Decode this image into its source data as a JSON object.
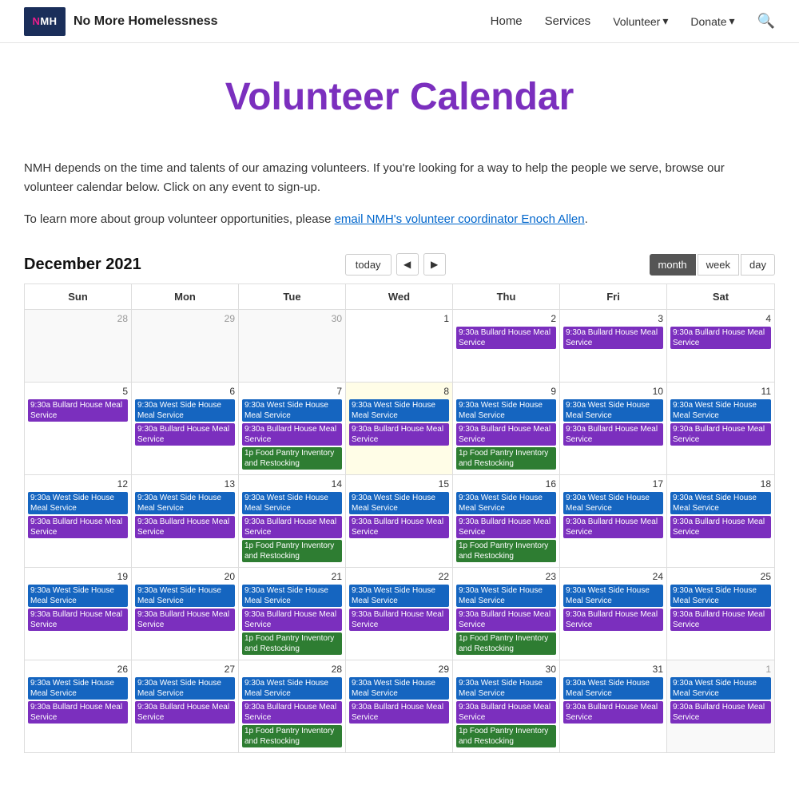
{
  "header": {
    "logo_text": "NMH",
    "site_name": "No More Homelessness",
    "nav": {
      "home": "Home",
      "services": "Services",
      "volunteer": "Volunteer",
      "donate": "Donate"
    }
  },
  "page": {
    "title": "Volunteer Calendar",
    "intro1": "NMH depends on the time and talents of our amazing volunteers. If you're looking for a way to help the people we serve, browse our volunteer calendar below. Click on any event to sign-up.",
    "intro2": "To learn more about group volunteer opportunities, please",
    "link_text": "email NMH's volunteer coordinator Enoch Allen",
    "intro2_end": "."
  },
  "calendar": {
    "month_title": "December 2021",
    "btn_today": "today",
    "btn_month": "month",
    "btn_week": "week",
    "btn_day": "day",
    "days_of_week": [
      "Sun",
      "Mon",
      "Tue",
      "Wed",
      "Thu",
      "Fri",
      "Sat"
    ],
    "events": {
      "bullard": "9:30a Bullard House Meal Service",
      "westside": "9:30a West Side House Meal Service",
      "foodpantry": "1p Food Pantry Inventory and Restocking"
    }
  }
}
